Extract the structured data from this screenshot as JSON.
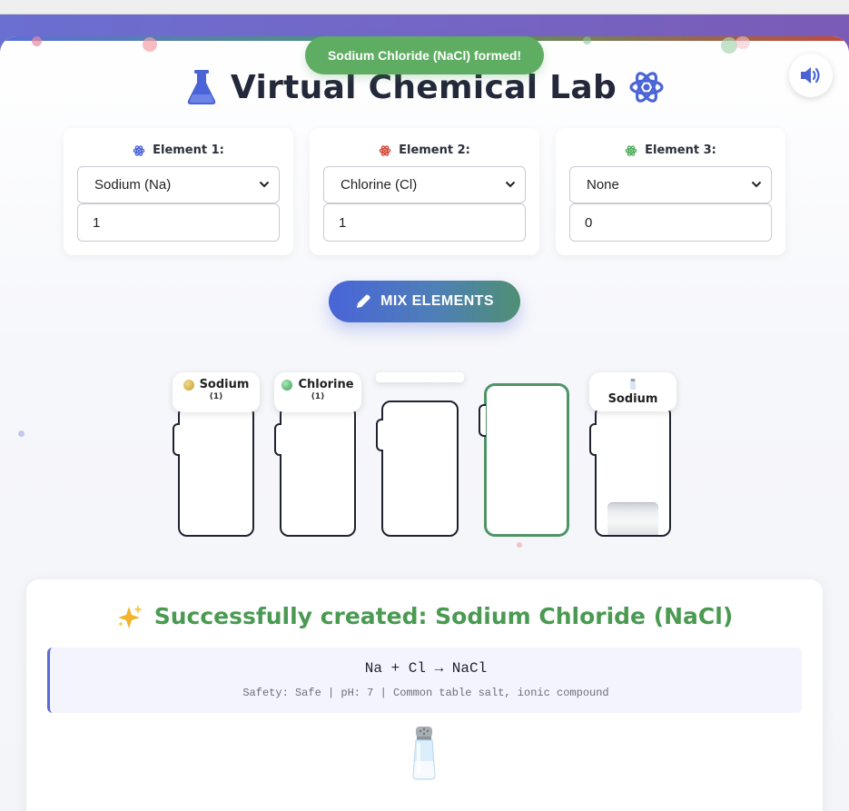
{
  "toast": {
    "text": "Sodium Chloride (NaCl) formed!"
  },
  "header": {
    "title": "Virtual Chemical Lab",
    "sound_icon": "volume-icon"
  },
  "elements": [
    {
      "label": "Element 1:",
      "icon_color": "#4a64d8",
      "selected": "Sodium (Na)",
      "quantity": "1"
    },
    {
      "label": "Element 2:",
      "icon_color": "#d24a3c",
      "selected": "Chlorine (Cl)",
      "quantity": "1"
    },
    {
      "label": "Element 3:",
      "icon_color": "#4fae5d",
      "selected": "None",
      "quantity": "0"
    }
  ],
  "mix_button": {
    "label": "MIX ELEMENTS"
  },
  "beakers": [
    {
      "name": "Sodium",
      "qty": "(1)",
      "dot_color": "#d9b64a"
    },
    {
      "name": "Chlorine",
      "qty": "(1)",
      "dot_color": "#5fbf74"
    },
    {
      "name": "",
      "qty": ""
    },
    {
      "name": "",
      "qty": ""
    },
    {
      "name": "Sodium",
      "qty": ""
    }
  ],
  "result": {
    "title": "Successfully created: Sodium Chloride (NaCl)",
    "equation": "Na + Cl → NaCl",
    "safety": "Safety: Safe | pH: 7 | Common table salt, ionic compound"
  },
  "colors": {
    "accent": "#4a64d8",
    "success": "#4a9a52",
    "toast": "#5fad63"
  }
}
